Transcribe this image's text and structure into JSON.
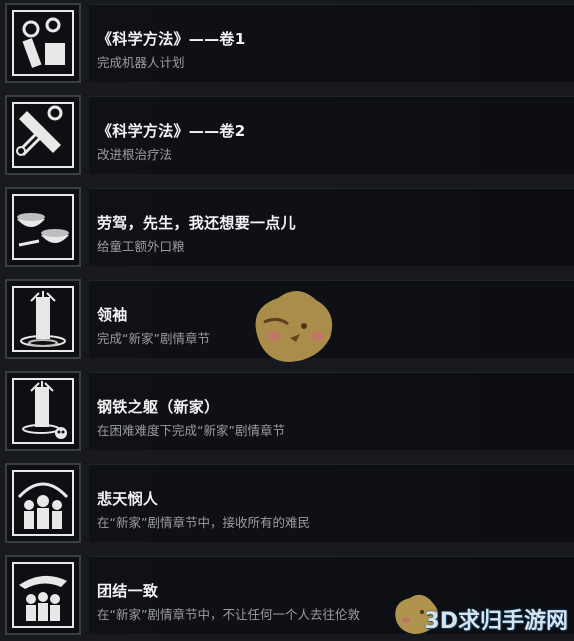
{
  "achievements": [
    {
      "title": "《科学方法》——卷1",
      "description": "完成机器人计划",
      "icon": "robot-arm-gears-icon"
    },
    {
      "title": "《科学方法》——卷2",
      "description": "改进根治疗法",
      "icon": "saw-scissors-icon"
    },
    {
      "title": "劳驾，先生，我还想要一点儿",
      "description": "给童工额外口粮",
      "icon": "food-bowls-icon"
    },
    {
      "title": "领袖",
      "description": "完成“新家”剧情章节",
      "icon": "generator-tower-icon"
    },
    {
      "title": "钢铁之躯（新家）",
      "description": "在困难难度下完成“新家”剧情章节",
      "icon": "generator-skull-icon"
    },
    {
      "title": "悲天悯人",
      "description": "在“新家”剧情章节中，接收所有的难民",
      "icon": "refugees-crowd-icon"
    },
    {
      "title": "团结一致",
      "description": "在“新家”剧情章节中，不让任何一个人去往伦敦",
      "icon": "protecting-hand-crowd-icon"
    }
  ],
  "watermark": "3D求归手游网",
  "colors": {
    "background": "#17191f",
    "panel": "#0f1116",
    "title": "#f3f3f3",
    "description": "#9a9ca2"
  }
}
